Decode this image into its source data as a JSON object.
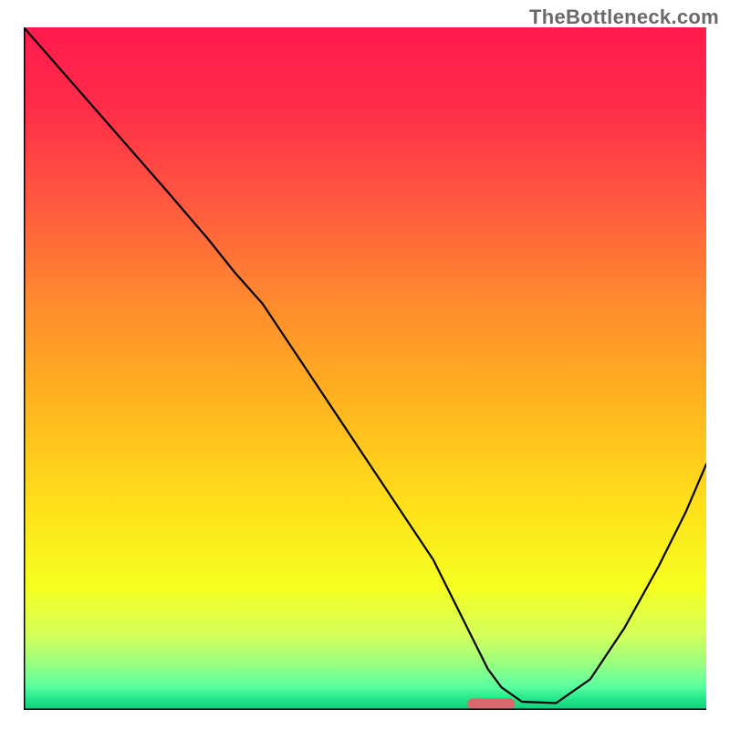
{
  "header": {
    "watermark_text": "TheBottleneck.com"
  },
  "colors": {
    "gradient_stops": [
      {
        "offset": 0.0,
        "color": "#ff1a4d"
      },
      {
        "offset": 0.12,
        "color": "#ff2d49"
      },
      {
        "offset": 0.25,
        "color": "#ff5640"
      },
      {
        "offset": 0.4,
        "color": "#ff8a2e"
      },
      {
        "offset": 0.55,
        "color": "#ffb41f"
      },
      {
        "offset": 0.7,
        "color": "#ffe01a"
      },
      {
        "offset": 0.82,
        "color": "#f6ff20"
      },
      {
        "offset": 0.89,
        "color": "#d4ff5a"
      },
      {
        "offset": 0.93,
        "color": "#9dff7e"
      },
      {
        "offset": 0.965,
        "color": "#5cffa0"
      },
      {
        "offset": 0.985,
        "color": "#20e68a"
      },
      {
        "offset": 1.0,
        "color": "#0fcf7a"
      }
    ],
    "axis": "#000000",
    "curve": "#000000",
    "marker": "#d86a6f"
  },
  "chart_data": {
    "type": "line",
    "title": "",
    "xlabel": "",
    "ylabel": "",
    "xlim": [
      0,
      100
    ],
    "ylim": [
      0,
      100
    ],
    "grid": false,
    "series": [
      {
        "name": "bottleneck-curve",
        "x": [
          0,
          7,
          14,
          21,
          27,
          31,
          35,
          40,
          45,
          50,
          55,
          60,
          63.5,
          66,
          68,
          70,
          73,
          78,
          83,
          88,
          93,
          97,
          100
        ],
        "y": [
          100,
          92,
          84,
          76,
          69,
          64,
          59.5,
          52,
          44.5,
          37,
          29.5,
          22,
          15,
          10,
          6,
          3.3,
          1.2,
          1.0,
          4.5,
          12,
          21,
          29,
          36
        ]
      }
    ],
    "marker": {
      "name": "optimal-range",
      "x_start": 65,
      "x_end": 72,
      "y": 0.9
    }
  }
}
